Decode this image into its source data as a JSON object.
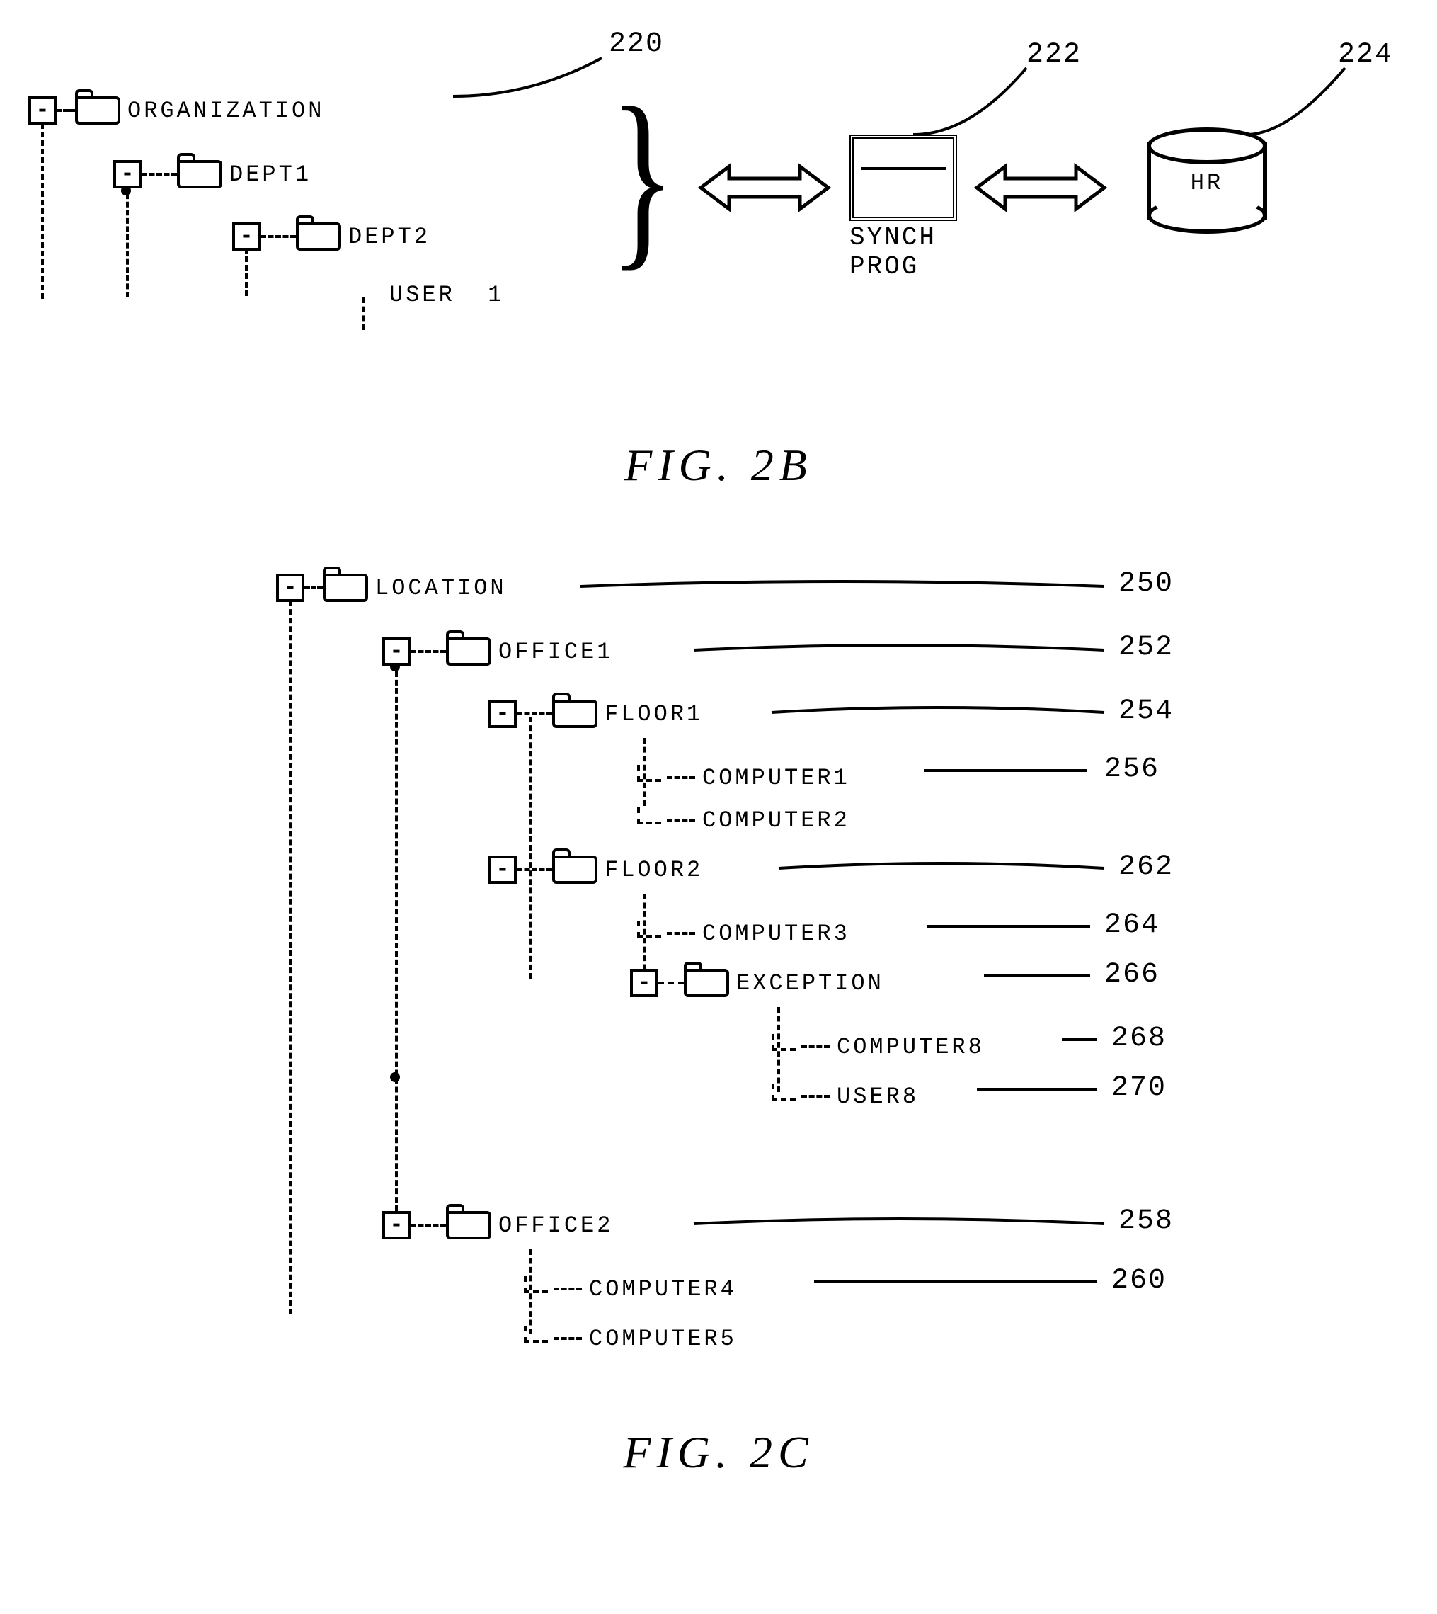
{
  "fig2b": {
    "caption": "FIG.  2B",
    "refs": {
      "org": "220",
      "synch": "222",
      "hr": "224"
    },
    "tree": {
      "root": {
        "label": "ORGANIZATION"
      },
      "dept1": {
        "label": "DEPT1"
      },
      "dept2": {
        "label": "DEPT2"
      },
      "user1": {
        "label": "USER  1"
      }
    },
    "synch_label": "SYNCH\nPROG",
    "hr_label": "HR"
  },
  "fig2c": {
    "caption": "FIG.  2C",
    "refs": {
      "location": "250",
      "office1": "252",
      "floor1": "254",
      "computer1": "256",
      "floor2": "262",
      "computer3": "264",
      "exception": "266",
      "computer8": "268",
      "user8": "270",
      "office2": "258",
      "computer4": "260"
    },
    "tree": {
      "root": {
        "label": "LOCATION"
      },
      "office1": {
        "label": "OFFICE1"
      },
      "floor1": {
        "label": "FLOOR1"
      },
      "computer1": {
        "label": "COMPUTER1"
      },
      "computer2": {
        "label": "COMPUTER2"
      },
      "floor2": {
        "label": "FLOOR2"
      },
      "computer3": {
        "label": "COMPUTER3"
      },
      "exception": {
        "label": "EXCEPTION"
      },
      "computer8": {
        "label": "COMPUTER8"
      },
      "user8": {
        "label": "USER8"
      },
      "office2": {
        "label": "OFFICE2"
      },
      "computer4": {
        "label": "COMPUTER4"
      },
      "computer5": {
        "label": "COMPUTER5"
      }
    }
  }
}
